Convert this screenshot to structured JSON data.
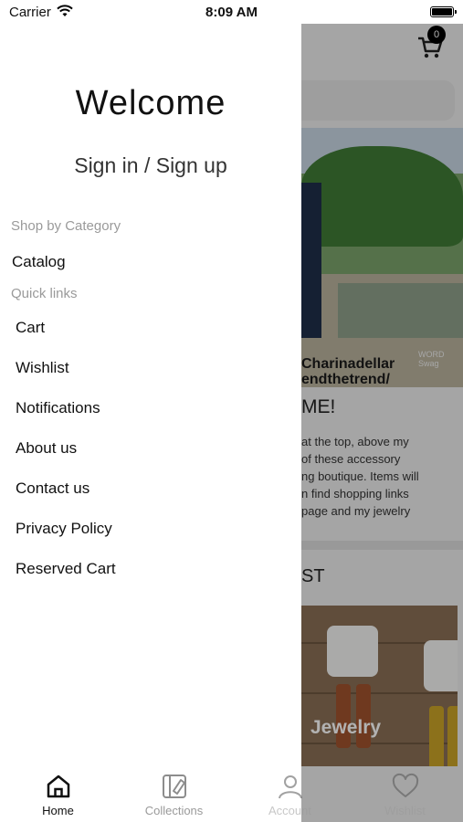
{
  "status_bar": {
    "carrier": "Carrier",
    "time": "8:09 AM"
  },
  "background": {
    "cart_count": "0",
    "hero_caption_line1": "Charinadellar",
    "hero_caption_line2": "endthetrend/",
    "hero_badge": "WORD Swag",
    "welcome_heading": "ME!",
    "blurb_lines": [
      "at the top, above my",
      "of these accessory",
      "ng boutique. Items will",
      "n find shopping links",
      "page and my jewelry"
    ],
    "section_title": "ST",
    "jewelry_label": "Jewelry"
  },
  "drawer": {
    "welcome": "Welcome",
    "sign_in": "Sign in / Sign up",
    "shop_by_category_label": "Shop by Category",
    "catalog": "Catalog",
    "quick_links_label": "Quick links",
    "quick_links": [
      "Cart",
      "Wishlist",
      "Notifications",
      "About us",
      "Contact us",
      "Privacy Policy",
      "Reserved Cart"
    ]
  },
  "tabs": [
    {
      "label": "Home",
      "icon": "home-icon",
      "active": true
    },
    {
      "label": "Collections",
      "icon": "collections-icon",
      "active": false
    },
    {
      "label": "Account",
      "icon": "account-icon",
      "active": false
    },
    {
      "label": "Wishlist",
      "icon": "heart-icon",
      "active": false
    }
  ]
}
